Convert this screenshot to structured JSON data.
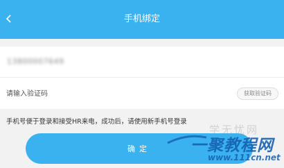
{
  "header": {
    "title": "手机绑定",
    "back_icon": "chevron-left-icon",
    "background": "#3ab2f0"
  },
  "form": {
    "phone_value": "13800007649",
    "code_placeholder": "请输入验证码",
    "get_code_label": "获取验证码"
  },
  "hint": "手机号便于登录和接受HR来电，成功后，请使用新手机号登录",
  "confirm_label": "确定",
  "watermark": {
    "top_text": "学无忧网",
    "main_text": "一聚教程网",
    "url_text": "www.111cn.net"
  },
  "colors": {
    "accent": "#3ab2f0",
    "watermark": "#165faf"
  }
}
